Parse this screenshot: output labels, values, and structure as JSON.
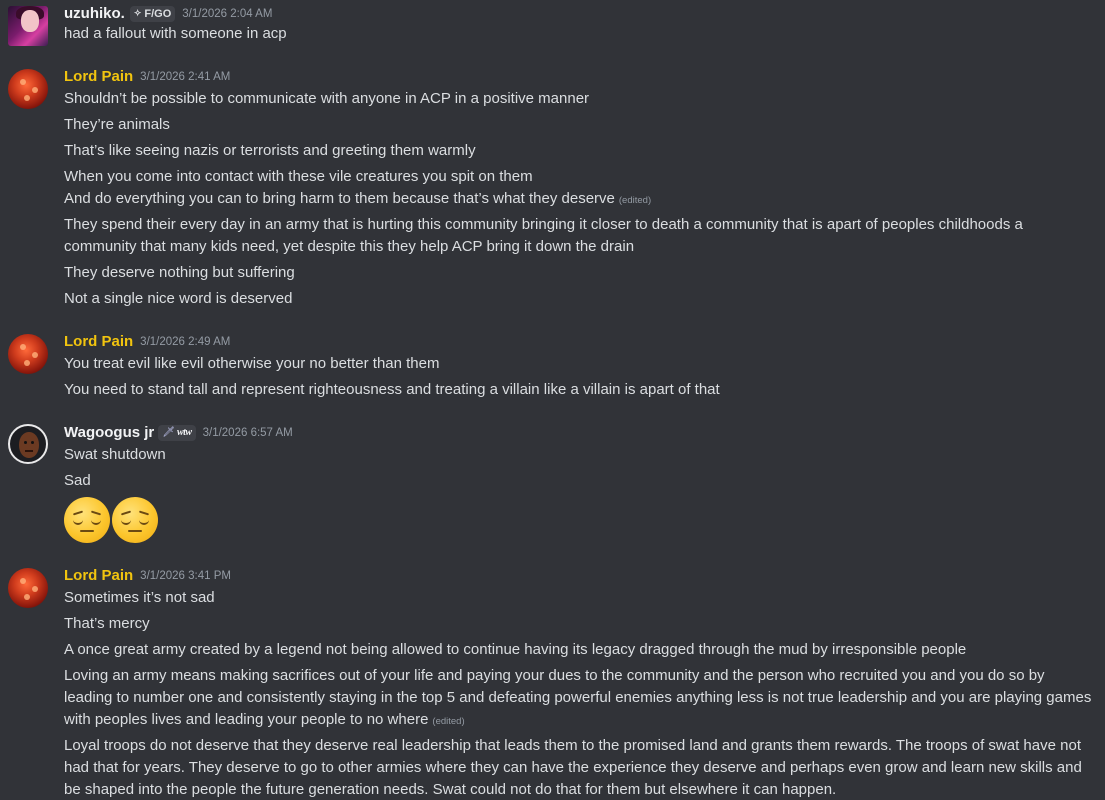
{
  "messages": [
    {
      "author": "uzuhiko.",
      "guild_tag": "F/GO",
      "timestamp": "3/1/2026 2:04 AM",
      "lines": [
        "had a fallout with someone in acp"
      ]
    },
    {
      "author": "Lord Pain",
      "timestamp": "3/1/2026 2:41 AM",
      "lines": [
        "Shouldn’t be possible to communicate with anyone in ACP in a positive manner",
        "They’re animals",
        "That’s like seeing nazis or terrorists and greeting them warmly",
        "When you come into contact with these vile creatures you spit on them",
        "And do everything you can to bring harm to them because that’s what they deserve",
        "They spend their every day in an army that is hurting this community bringing it closer to death a community that is apart of peoples childhoods a community that many kids need, yet despite this they help ACP bring it down the drain",
        "They deserve nothing but suffering",
        "Not a single nice word is deserved"
      ],
      "edited_label": "(edited)"
    },
    {
      "author": "Lord Pain",
      "timestamp": "3/1/2026 2:49 AM",
      "lines": [
        "You treat evil like evil otherwise your no better than them",
        "You need to stand tall and represent righteousness and treating a villain like a villain is apart of that"
      ]
    },
    {
      "author": "Wagoogus jr",
      "badge_text": "wtw",
      "timestamp": "3/1/2026 6:57 AM",
      "lines": [
        "Swat shutdown",
        "Sad"
      ],
      "emojis": [
        "pensive-face-icon",
        "pensive-face-icon"
      ]
    },
    {
      "author": "Lord Pain",
      "timestamp": "3/1/2026 3:41 PM",
      "lines": [
        "Sometimes it’s not sad",
        "That’s mercy",
        "A once great army created by a legend not being allowed to continue having its legacy dragged through the mud by irresponsible people",
        "Loving an army means making sacrifices out of your life and paying your dues to the community and the person who recruited you and you do so by leading to number one and consistently staying in the top 5 and defeating powerful enemies anything less is not true leadership and you are playing games with peoples lives and leading your people to no where",
        "Loyal troops do not deserve that they deserve real leadership that leads them to the promised land and grants them rewards. The troops of swat have not had that for years. They deserve to go to other armies where they can have the experience they deserve and perhaps even grow and learn new skills and be shaped into the people the future generation needs. Swat could not do that for them but elsewhere it can happen."
      ],
      "edited_label": "(edited)"
    }
  ],
  "colors": {
    "background": "#313338",
    "text": "#dbdee1",
    "muted": "#949ba4",
    "role_gold": "#f1c40f"
  }
}
